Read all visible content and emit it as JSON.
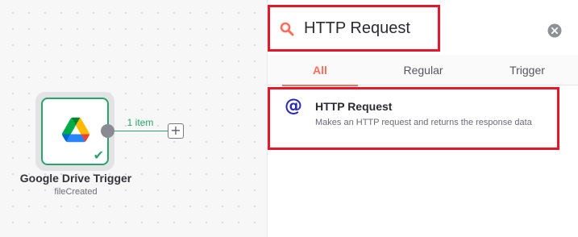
{
  "canvas": {
    "node": {
      "title": "Google Drive Trigger",
      "subtitle": "fileCreated",
      "icon": "google-drive-icon",
      "status_icon": "check-icon"
    },
    "connection": {
      "label": "1 item",
      "add_icon": "plus-icon"
    }
  },
  "panel": {
    "search": {
      "icon": "search-icon",
      "value": "HTTP Request",
      "clear_icon": "clear-icon"
    },
    "tabs": [
      {
        "label": "All",
        "active": true
      },
      {
        "label": "Regular",
        "active": false
      },
      {
        "label": "Trigger",
        "active": false
      }
    ],
    "results": [
      {
        "icon": "at-icon",
        "title": "HTTP Request",
        "description": "Makes an HTTP request and returns the response data"
      }
    ]
  },
  "colors": {
    "accent": "#ff6d5a",
    "success": "#29a36a",
    "highlight_border": "#e3182d",
    "http_icon": "#2a2ab8"
  }
}
